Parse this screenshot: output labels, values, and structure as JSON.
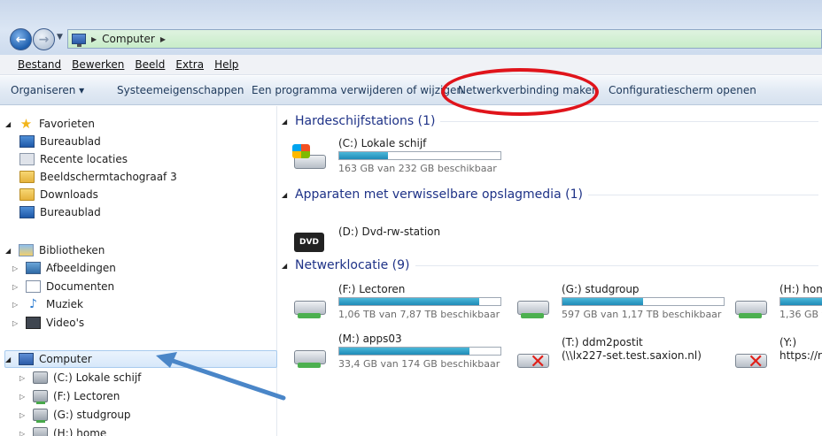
{
  "window": {
    "breadcrumb": [
      "Computer"
    ]
  },
  "menubar": [
    "Bestand",
    "Bewerken",
    "Beeld",
    "Extra",
    "Help"
  ],
  "commandbar": {
    "organize": "Organiseren ▾",
    "system_properties": "Systeemeigenschappen",
    "uninstall": "Een programma verwijderen of wijzigen",
    "map_network": "Netwerkverbinding maken",
    "control_panel": "Configuratiescherm openen"
  },
  "navpane": {
    "favorites": {
      "title": "Favorieten",
      "items": [
        "Bureaublad",
        "Recente locaties",
        "Beeldschermtachograaf 3",
        "Downloads",
        "Bureaublad"
      ]
    },
    "libraries": {
      "title": "Bibliotheken",
      "items": [
        "Afbeeldingen",
        "Documenten",
        "Muziek",
        "Video's"
      ]
    },
    "computer": {
      "title": "Computer",
      "items": [
        "(C:) Lokale schijf",
        "(F:) Lectoren",
        "(G:) studgroup",
        "(H:) home"
      ]
    }
  },
  "groups": {
    "hdd": {
      "title": "Hardeschijfstations (1)"
    },
    "removable": {
      "title": "Apparaten met verwisselbare opslagmedia (1)"
    },
    "network": {
      "title": "Netwerklocatie (9)"
    }
  },
  "drives": {
    "c": {
      "name": "(C:) Lokale schijf",
      "free": "163 GB van 232 GB beschikbaar",
      "used_fraction": 0.3
    },
    "d": {
      "name": "(D:) Dvd-rw-station",
      "icon_text": "DVD"
    },
    "f": {
      "name": "(F:) Lectoren",
      "free": "1,06 TB van 7,87 TB beschikbaar",
      "used_fraction": 0.87
    },
    "g": {
      "name": "(G:) studgroup",
      "free": "597 GB van 1,17 TB beschikbaar",
      "used_fraction": 0.5
    },
    "h": {
      "name": "(H:) hom",
      "free": "1,36 GB v",
      "used_fraction": 0.9
    },
    "m": {
      "name": "(M:) apps03",
      "free": "33,4 GB van 174 GB beschikbaar",
      "used_fraction": 0.81
    },
    "t": {
      "name": "(T:) ddm2postit",
      "path": "(\\\\lx227-set.test.saxion.nl)"
    },
    "y": {
      "name": "(Y:)",
      "path": "https://re"
    }
  },
  "colors": {
    "annotation_ellipse": "#e0141b",
    "annotation_arrow": "#4a86c8",
    "group_title": "#1e3287",
    "drive_fill": "#1f8bb8"
  }
}
